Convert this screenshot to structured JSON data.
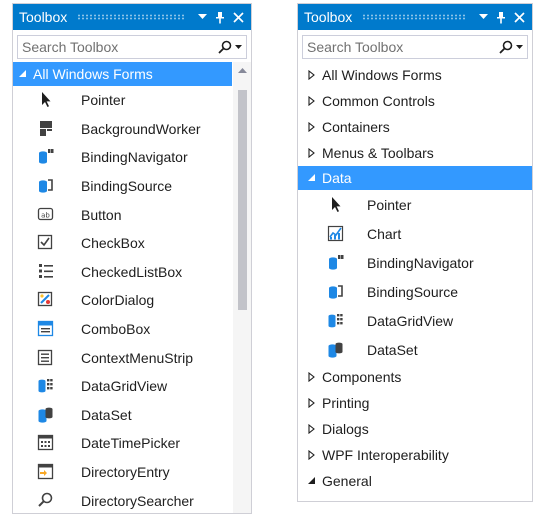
{
  "left_panel": {
    "title": "Toolbox",
    "search_placeholder": "Search Toolbox",
    "category": "All Windows Forms",
    "items": [
      {
        "label": "Pointer",
        "icon": "pointer-icon"
      },
      {
        "label": "BackgroundWorker",
        "icon": "background-worker-icon"
      },
      {
        "label": "BindingNavigator",
        "icon": "binding-navigator-icon"
      },
      {
        "label": "BindingSource",
        "icon": "binding-source-icon"
      },
      {
        "label": "Button",
        "icon": "button-icon"
      },
      {
        "label": "CheckBox",
        "icon": "checkbox-icon"
      },
      {
        "label": "CheckedListBox",
        "icon": "checked-listbox-icon"
      },
      {
        "label": "ColorDialog",
        "icon": "color-dialog-icon"
      },
      {
        "label": "ComboBox",
        "icon": "combobox-icon"
      },
      {
        "label": "ContextMenuStrip",
        "icon": "context-menu-strip-icon"
      },
      {
        "label": "DataGridView",
        "icon": "datagridview-icon"
      },
      {
        "label": "DataSet",
        "icon": "dataset-icon"
      },
      {
        "label": "DateTimePicker",
        "icon": "datetimepicker-icon"
      },
      {
        "label": "DirectoryEntry",
        "icon": "directory-entry-icon"
      },
      {
        "label": "DirectorySearcher",
        "icon": "directory-searcher-icon"
      }
    ]
  },
  "right_panel": {
    "title": "Toolbox",
    "search_placeholder": "Search Toolbox",
    "categories_before": [
      "All Windows Forms",
      "Common Controls",
      "Containers",
      "Menus & Toolbars"
    ],
    "expanded_category": "Data",
    "data_items": [
      {
        "label": "Pointer",
        "icon": "pointer-icon"
      },
      {
        "label": "Chart",
        "icon": "chart-icon"
      },
      {
        "label": "BindingNavigator",
        "icon": "binding-navigator-icon"
      },
      {
        "label": "BindingSource",
        "icon": "binding-source-icon"
      },
      {
        "label": "DataGridView",
        "icon": "datagridview-icon"
      },
      {
        "label": "DataSet",
        "icon": "dataset-icon"
      }
    ],
    "categories_after": [
      "Components",
      "Printing",
      "Dialogs",
      "WPF Interoperability"
    ],
    "last_category": "General"
  },
  "colors": {
    "title_bar": "#007acc",
    "selection": "#3399ff",
    "icon_blue": "#1e88e5",
    "icon_dark": "#424242"
  }
}
